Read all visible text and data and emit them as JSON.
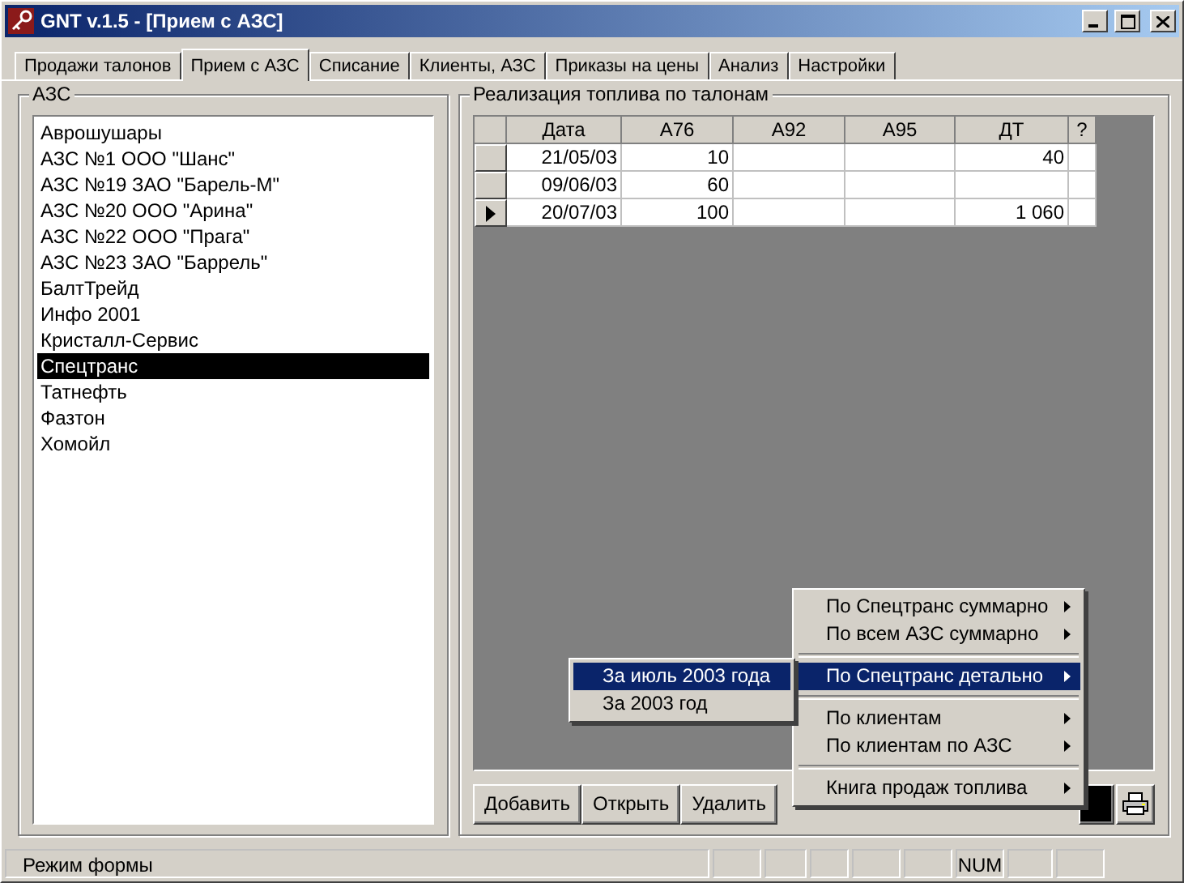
{
  "window": {
    "title": "GNT v.1.5 - [Прием с  АЗС]"
  },
  "tabs": [
    {
      "label": "Продажи талонов",
      "selected": false
    },
    {
      "label": "Прием с  АЗС",
      "selected": true
    },
    {
      "label": "Списание",
      "selected": false
    },
    {
      "label": "Клиенты, АЗС",
      "selected": false
    },
    {
      "label": "Приказы на цены",
      "selected": false
    },
    {
      "label": "Анализ",
      "selected": false
    },
    {
      "label": "Настройки",
      "selected": false
    }
  ],
  "stations": {
    "title": "АЗС",
    "items": [
      {
        "label": "Аврошушары",
        "selected": false
      },
      {
        "label": "АЗС №1 ООО \"Шанс\"",
        "selected": false
      },
      {
        "label": "АЗС №19 ЗАО \"Барель-М\"",
        "selected": false
      },
      {
        "label": "АЗС №20 ООО \"Арина\"",
        "selected": false
      },
      {
        "label": "АЗС №22 ООО \"Прага\"",
        "selected": false
      },
      {
        "label": "АЗС №23 ЗАО \"Баррель\"",
        "selected": false
      },
      {
        "label": "БалтТрейд",
        "selected": false
      },
      {
        "label": "Инфо 2001",
        "selected": false
      },
      {
        "label": "Кристалл-Сервис",
        "selected": false
      },
      {
        "label": "Спецтранс",
        "selected": true
      },
      {
        "label": "Татнефть",
        "selected": false
      },
      {
        "label": "Фазтон",
        "selected": false
      },
      {
        "label": "Хомойл",
        "selected": false
      }
    ]
  },
  "sales": {
    "title": "Реализация топлива по талонам",
    "columns": [
      "Дата",
      "А76",
      "А92",
      "А95",
      "ДТ",
      "?"
    ],
    "rows": [
      {
        "cells": [
          "21/05/03",
          "10",
          "",
          "",
          "40",
          ""
        ],
        "selected": false
      },
      {
        "cells": [
          "09/06/03",
          "60",
          "",
          "",
          "",
          ""
        ],
        "selected": false
      },
      {
        "cells": [
          "20/07/03",
          "100",
          "",
          "",
          "1 060",
          ""
        ],
        "selected": true
      }
    ],
    "buttons": [
      "Добавить",
      "Открыть",
      "Удалить"
    ]
  },
  "menu": {
    "items": [
      {
        "kind": "item",
        "label": "По Спецтранс суммарно",
        "selected": false
      },
      {
        "kind": "item",
        "label": "По всем АЗС суммарно",
        "selected": false
      },
      {
        "kind": "separator"
      },
      {
        "kind": "item",
        "label": "По Спецтранс детально",
        "selected": true
      },
      {
        "kind": "separator"
      },
      {
        "kind": "item",
        "label": "По клиентам",
        "selected": false
      },
      {
        "kind": "item",
        "label": "По клиентам по АЗС",
        "selected": false
      },
      {
        "kind": "separator"
      },
      {
        "kind": "item",
        "label": "Книга продаж топлива",
        "selected": false
      }
    ],
    "submenu": [
      {
        "label": "За июль 2003 года",
        "selected": true
      },
      {
        "label": "За 2003 год",
        "selected": false
      }
    ]
  },
  "status_bar": {
    "text": "Режим формы",
    "indicator": "NUM"
  }
}
